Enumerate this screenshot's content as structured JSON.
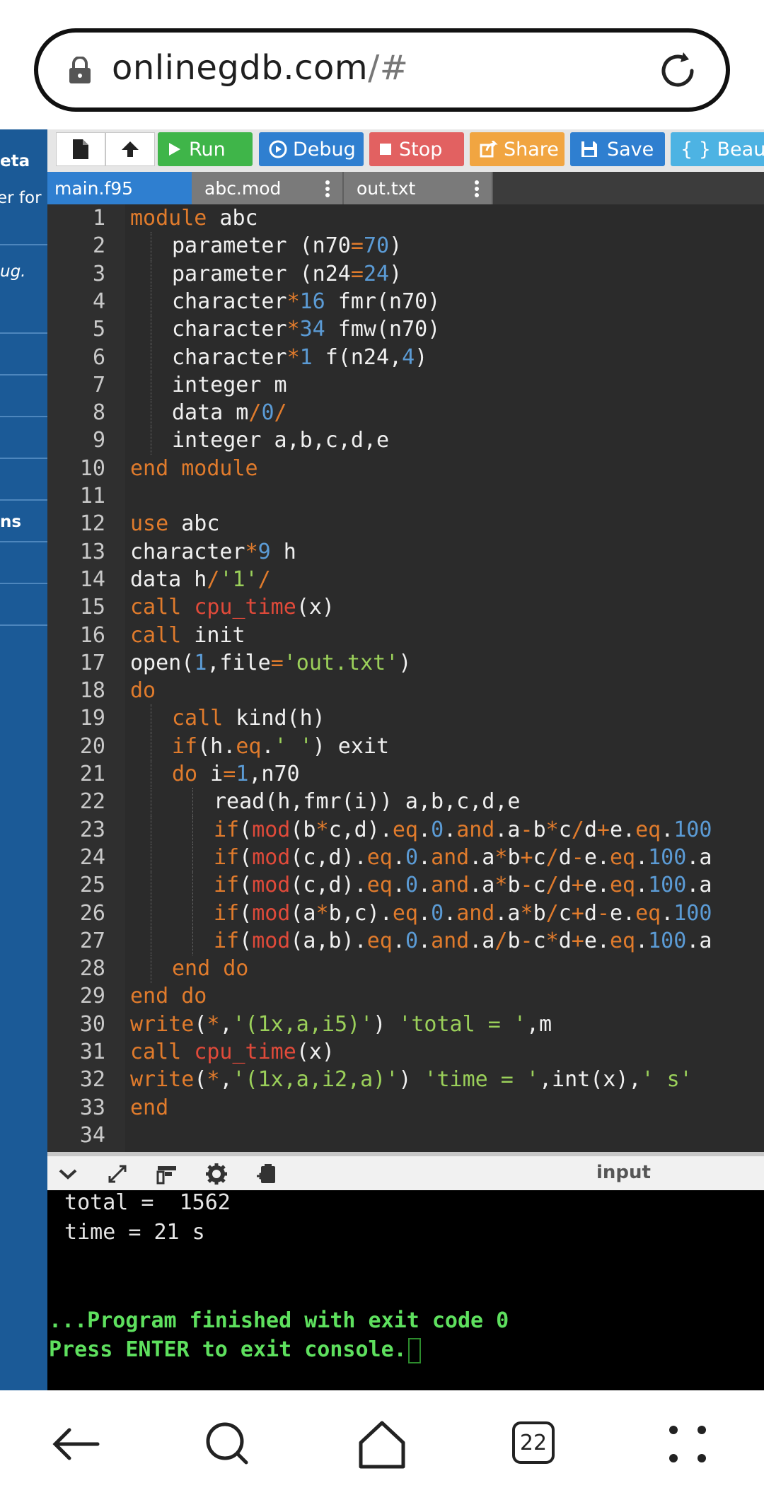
{
  "browser": {
    "url_main": "onlinegdb.com",
    "url_suffix": "/#",
    "tab_count": "22"
  },
  "sidebar": {
    "texts": [
      "eta",
      "er for",
      "ug.",
      "ns"
    ]
  },
  "toolbar": {
    "run_label": "Run",
    "debug_label": "Debug",
    "stop_label": "Stop",
    "share_label": "Share",
    "save_label": "Save",
    "beautify_label": "{ } Beautif",
    "colors": {
      "run": "#3fb549",
      "debug": "#2f7fd0",
      "stop": "#e26161",
      "share": "#f1a541",
      "save": "#2f7fd0",
      "beautify": "#4db3e3"
    }
  },
  "tabs": [
    {
      "label": "main.f95",
      "active": true
    },
    {
      "label": "abc.mod",
      "active": false
    },
    {
      "label": "out.txt",
      "active": false
    }
  ],
  "editor": {
    "lines": [
      {
        "n": "1",
        "indent": 0,
        "tokens": [
          [
            "kw",
            "module"
          ],
          [
            "p",
            " abc"
          ]
        ]
      },
      {
        "n": "2",
        "indent": 1,
        "tokens": [
          [
            "p",
            "parameter (n70"
          ],
          [
            "op",
            "="
          ],
          [
            "num",
            "70"
          ],
          [
            "p",
            ")"
          ]
        ]
      },
      {
        "n": "3",
        "indent": 1,
        "tokens": [
          [
            "p",
            "parameter (n24"
          ],
          [
            "op",
            "="
          ],
          [
            "num",
            "24"
          ],
          [
            "p",
            ")"
          ]
        ]
      },
      {
        "n": "4",
        "indent": 1,
        "tokens": [
          [
            "p",
            "character"
          ],
          [
            "op",
            "*"
          ],
          [
            "num",
            "16"
          ],
          [
            "p",
            " fmr(n70)"
          ]
        ]
      },
      {
        "n": "5",
        "indent": 1,
        "tokens": [
          [
            "p",
            "character"
          ],
          [
            "op",
            "*"
          ],
          [
            "num",
            "34"
          ],
          [
            "p",
            " fmw(n70)"
          ]
        ]
      },
      {
        "n": "6",
        "indent": 1,
        "tokens": [
          [
            "p",
            "character"
          ],
          [
            "op",
            "*"
          ],
          [
            "num",
            "1"
          ],
          [
            "p",
            " f(n24,"
          ],
          [
            "num",
            "4"
          ],
          [
            "p",
            ")"
          ]
        ]
      },
      {
        "n": "7",
        "indent": 1,
        "tokens": [
          [
            "p",
            "integer m"
          ]
        ]
      },
      {
        "n": "8",
        "indent": 1,
        "tokens": [
          [
            "p",
            "data m"
          ],
          [
            "op",
            "/"
          ],
          [
            "num",
            "0"
          ],
          [
            "op",
            "/"
          ]
        ]
      },
      {
        "n": "9",
        "indent": 1,
        "tokens": [
          [
            "p",
            "integer a,b,c,d,e"
          ]
        ]
      },
      {
        "n": "10",
        "indent": 0,
        "tokens": [
          [
            "kw",
            "end module"
          ]
        ]
      },
      {
        "n": "11",
        "indent": 0,
        "tokens": []
      },
      {
        "n": "12",
        "indent": 0,
        "tokens": [
          [
            "kw",
            "use"
          ],
          [
            "p",
            " abc"
          ]
        ]
      },
      {
        "n": "13",
        "indent": 0,
        "tokens": [
          [
            "p",
            "character"
          ],
          [
            "op",
            "*"
          ],
          [
            "num",
            "9"
          ],
          [
            "p",
            " h"
          ]
        ]
      },
      {
        "n": "14",
        "indent": 0,
        "tokens": [
          [
            "p",
            "data h"
          ],
          [
            "op",
            "/"
          ],
          [
            "str",
            "'1'"
          ],
          [
            "op",
            "/"
          ]
        ]
      },
      {
        "n": "15",
        "indent": 0,
        "tokens": [
          [
            "kw",
            "call"
          ],
          [
            "p",
            " "
          ],
          [
            "fn",
            "cpu_time"
          ],
          [
            "p",
            "(x)"
          ]
        ]
      },
      {
        "n": "16",
        "indent": 0,
        "tokens": [
          [
            "kw",
            "call"
          ],
          [
            "p",
            " init"
          ]
        ]
      },
      {
        "n": "17",
        "indent": 0,
        "tokens": [
          [
            "p",
            "open("
          ],
          [
            "num",
            "1"
          ],
          [
            "p",
            ",file"
          ],
          [
            "op",
            "="
          ],
          [
            "str",
            "'out.txt'"
          ],
          [
            "p",
            ")"
          ]
        ]
      },
      {
        "n": "18",
        "indent": 0,
        "tokens": [
          [
            "kw",
            "do"
          ]
        ]
      },
      {
        "n": "19",
        "indent": 1,
        "tokens": [
          [
            "kw",
            "call"
          ],
          [
            "p",
            " kind(h)"
          ]
        ]
      },
      {
        "n": "20",
        "indent": 1,
        "tokens": [
          [
            "kw",
            "if"
          ],
          [
            "p",
            "(h."
          ],
          [
            "op",
            "eq"
          ],
          [
            "p",
            "."
          ],
          [
            "str",
            "' '"
          ],
          [
            "p",
            ") exit"
          ]
        ]
      },
      {
        "n": "21",
        "indent": 1,
        "tokens": [
          [
            "kw",
            "do"
          ],
          [
            "p",
            " i"
          ],
          [
            "op",
            "="
          ],
          [
            "num",
            "1"
          ],
          [
            "p",
            ",n70"
          ]
        ]
      },
      {
        "n": "22",
        "indent": 2,
        "tokens": [
          [
            "p",
            "read(h,fmr(i)) a,b,c,d,e"
          ]
        ]
      },
      {
        "n": "23",
        "indent": 2,
        "tokens": [
          [
            "kw",
            "if"
          ],
          [
            "p",
            "("
          ],
          [
            "fn",
            "mod"
          ],
          [
            "p",
            "(b"
          ],
          [
            "op",
            "*"
          ],
          [
            "p",
            "c,d)."
          ],
          [
            "op",
            "eq"
          ],
          [
            "p",
            "."
          ],
          [
            "num",
            "0"
          ],
          [
            "p",
            "."
          ],
          [
            "op",
            "and"
          ],
          [
            "p",
            ".a"
          ],
          [
            "op",
            "-"
          ],
          [
            "p",
            "b"
          ],
          [
            "op",
            "*"
          ],
          [
            "p",
            "c"
          ],
          [
            "op",
            "/"
          ],
          [
            "p",
            "d"
          ],
          [
            "op",
            "+"
          ],
          [
            "p",
            "e."
          ],
          [
            "op",
            "eq"
          ],
          [
            "p",
            "."
          ],
          [
            "num",
            "100"
          ]
        ]
      },
      {
        "n": "24",
        "indent": 2,
        "tokens": [
          [
            "kw",
            "if"
          ],
          [
            "p",
            "("
          ],
          [
            "fn",
            "mod"
          ],
          [
            "p",
            "(c,d)."
          ],
          [
            "op",
            "eq"
          ],
          [
            "p",
            "."
          ],
          [
            "num",
            "0"
          ],
          [
            "p",
            "."
          ],
          [
            "op",
            "and"
          ],
          [
            "p",
            ".a"
          ],
          [
            "op",
            "*"
          ],
          [
            "p",
            "b"
          ],
          [
            "op",
            "+"
          ],
          [
            "p",
            "c"
          ],
          [
            "op",
            "/"
          ],
          [
            "p",
            "d"
          ],
          [
            "op",
            "-"
          ],
          [
            "p",
            "e."
          ],
          [
            "op",
            "eq"
          ],
          [
            "p",
            "."
          ],
          [
            "num",
            "100"
          ],
          [
            "p",
            ".a"
          ]
        ]
      },
      {
        "n": "25",
        "indent": 2,
        "tokens": [
          [
            "kw",
            "if"
          ],
          [
            "p",
            "("
          ],
          [
            "fn",
            "mod"
          ],
          [
            "p",
            "(c,d)."
          ],
          [
            "op",
            "eq"
          ],
          [
            "p",
            "."
          ],
          [
            "num",
            "0"
          ],
          [
            "p",
            "."
          ],
          [
            "op",
            "and"
          ],
          [
            "p",
            ".a"
          ],
          [
            "op",
            "*"
          ],
          [
            "p",
            "b"
          ],
          [
            "op",
            "-"
          ],
          [
            "p",
            "c"
          ],
          [
            "op",
            "/"
          ],
          [
            "p",
            "d"
          ],
          [
            "op",
            "+"
          ],
          [
            "p",
            "e."
          ],
          [
            "op",
            "eq"
          ],
          [
            "p",
            "."
          ],
          [
            "num",
            "100"
          ],
          [
            "p",
            ".a"
          ]
        ]
      },
      {
        "n": "26",
        "indent": 2,
        "tokens": [
          [
            "kw",
            "if"
          ],
          [
            "p",
            "("
          ],
          [
            "fn",
            "mod"
          ],
          [
            "p",
            "(a"
          ],
          [
            "op",
            "*"
          ],
          [
            "p",
            "b,c)."
          ],
          [
            "op",
            "eq"
          ],
          [
            "p",
            "."
          ],
          [
            "num",
            "0"
          ],
          [
            "p",
            "."
          ],
          [
            "op",
            "and"
          ],
          [
            "p",
            ".a"
          ],
          [
            "op",
            "*"
          ],
          [
            "p",
            "b"
          ],
          [
            "op",
            "/"
          ],
          [
            "p",
            "c"
          ],
          [
            "op",
            "+"
          ],
          [
            "p",
            "d"
          ],
          [
            "op",
            "-"
          ],
          [
            "p",
            "e."
          ],
          [
            "op",
            "eq"
          ],
          [
            "p",
            "."
          ],
          [
            "num",
            "100"
          ]
        ]
      },
      {
        "n": "27",
        "indent": 2,
        "tokens": [
          [
            "kw",
            "if"
          ],
          [
            "p",
            "("
          ],
          [
            "fn",
            "mod"
          ],
          [
            "p",
            "(a,b)."
          ],
          [
            "op",
            "eq"
          ],
          [
            "p",
            "."
          ],
          [
            "num",
            "0"
          ],
          [
            "p",
            "."
          ],
          [
            "op",
            "and"
          ],
          [
            "p",
            ".a"
          ],
          [
            "op",
            "/"
          ],
          [
            "p",
            "b"
          ],
          [
            "op",
            "-"
          ],
          [
            "p",
            "c"
          ],
          [
            "op",
            "*"
          ],
          [
            "p",
            "d"
          ],
          [
            "op",
            "+"
          ],
          [
            "p",
            "e."
          ],
          [
            "op",
            "eq"
          ],
          [
            "p",
            "."
          ],
          [
            "num",
            "100"
          ],
          [
            "p",
            ".a"
          ]
        ]
      },
      {
        "n": "28",
        "indent": 1,
        "tokens": [
          [
            "kw",
            "end do"
          ]
        ]
      },
      {
        "n": "29",
        "indent": 0,
        "tokens": [
          [
            "kw",
            "end do"
          ]
        ]
      },
      {
        "n": "30",
        "indent": 0,
        "tokens": [
          [
            "kw",
            "write"
          ],
          [
            "p",
            "("
          ],
          [
            "op",
            "*"
          ],
          [
            "p",
            ","
          ],
          [
            "str",
            "'(1x,a,i5)'"
          ],
          [
            "p",
            ") "
          ],
          [
            "str",
            "'total = '"
          ],
          [
            "p",
            ",m"
          ]
        ]
      },
      {
        "n": "31",
        "indent": 0,
        "tokens": [
          [
            "kw",
            "call"
          ],
          [
            "p",
            " "
          ],
          [
            "fn",
            "cpu_time"
          ],
          [
            "p",
            "(x)"
          ]
        ]
      },
      {
        "n": "32",
        "indent": 0,
        "tokens": [
          [
            "kw",
            "write"
          ],
          [
            "p",
            "("
          ],
          [
            "op",
            "*"
          ],
          [
            "p",
            ","
          ],
          [
            "str",
            "'(1x,a,i2,a)'"
          ],
          [
            "p",
            ") "
          ],
          [
            "str",
            "'time = '"
          ],
          [
            "p",
            ",int(x),"
          ],
          [
            "str",
            "' s'"
          ]
        ]
      },
      {
        "n": "33",
        "indent": 0,
        "tokens": [
          [
            "kw",
            "end"
          ]
        ]
      },
      {
        "n": "34",
        "indent": 0,
        "tokens": []
      }
    ],
    "colors": {
      "kw": "#e07b2c",
      "fn": "#e04a3a",
      "num": "#5b9bd5",
      "str": "#9bd05a",
      "op": "#e07b2c",
      "p": "#f0f0f0"
    }
  },
  "console_bar": {
    "input_label": "input"
  },
  "console": {
    "total_line": " total =  1562",
    "time_line": " time = 21 s",
    "finished_line": "...Program finished with exit code 0",
    "press_line": "Press ENTER to exit console."
  }
}
